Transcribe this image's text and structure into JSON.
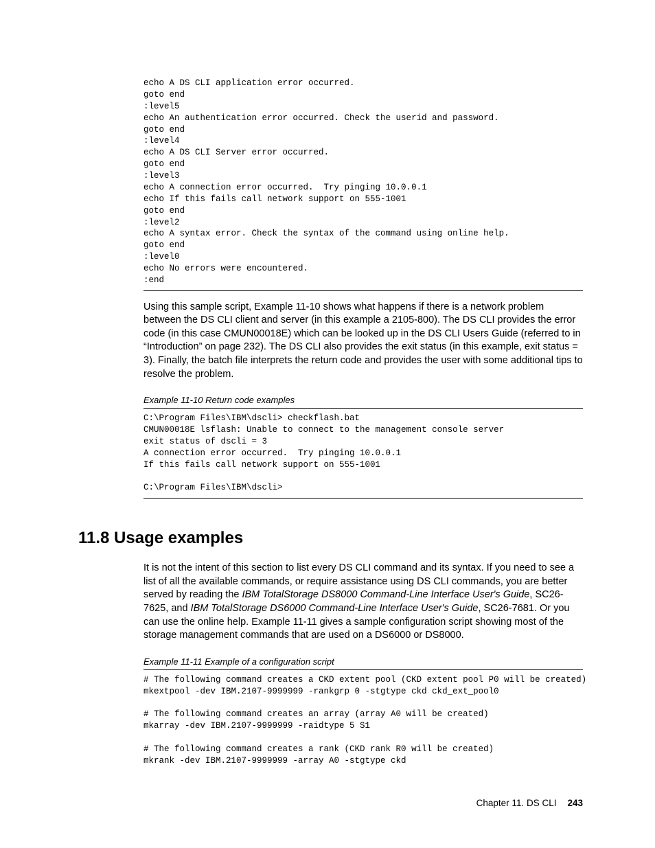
{
  "code1": "echo A DS CLI application error occurred.\ngoto end\n:level5\necho An authentication error occurred. Check the userid and password.\ngoto end\n:level4\necho A DS CLI Server error occurred.\ngoto end\n:level3\necho A connection error occurred.  Try pinging 10.0.0.1\necho If this fails call network support on 555-1001\ngoto end\n:level2\necho A syntax error. Check the syntax of the command using online help.\ngoto end\n:level0\necho No errors were encountered.\n:end",
  "para1": "Using this sample script, Example 11-10 shows what happens if there is a network problem between the DS CLI client and server (in this example a 2105-800). The DS CLI provides the error code (in this case CMUN00018E) which can be looked up in the DS CLI Users Guide (referred to in “Introduction” on page 232). The DS CLI also provides the exit status (in this example, exit status = 3). Finally, the batch file interprets the return code and provides the user with some additional tips to resolve the problem.",
  "example10_caption": "Example 11-10   Return code examples",
  "code2": "C:\\Program Files\\IBM\\dscli> checkflash.bat\nCMUN00018E lsflash: Unable to connect to the management console server\nexit status of dscli = 3\nA connection error occurred.  Try pinging 10.0.0.1\nIf this fails call network support on 555-1001\n\nC:\\Program Files\\IBM\\dscli>",
  "section_heading": "11.8  Usage examples",
  "para2_pre": "It is not the intent of this section to list every DS CLI command and its syntax. If you need to see a list of all the available commands, or require assistance using DS CLI commands, you are better served by reading the ",
  "para2_ital1": "IBM TotalStorage DS8000 Command-Line Interface User's Guide",
  "para2_mid1": ", SC26-7625, and ",
  "para2_ital2": "IBM TotalStorage DS6000 Command-Line Interface User's Guide",
  "para2_post": ", SC26-7681. Or you can use the online help. Example 11-11 gives a sample configuration script showing most of the storage management commands that are used on a DS6000 or DS8000.",
  "example11_caption": "Example 11-11   Example of a configuration script",
  "code3": "# The following command creates a CKD extent pool (CKD extent pool P0 will be created)\nmkextpool -dev IBM.2107-9999999 -rankgrp 0 -stgtype ckd ckd_ext_pool0\n\n# The following command creates an array (array A0 will be created)\nmkarray -dev IBM.2107-9999999 -raidtype 5 S1\n\n# The following command creates a rank (CKD rank R0 will be created)\nmkrank -dev IBM.2107-9999999 -array A0 -stgtype ckd",
  "footer_chapter": "Chapter 11. DS CLI",
  "footer_page": "243"
}
